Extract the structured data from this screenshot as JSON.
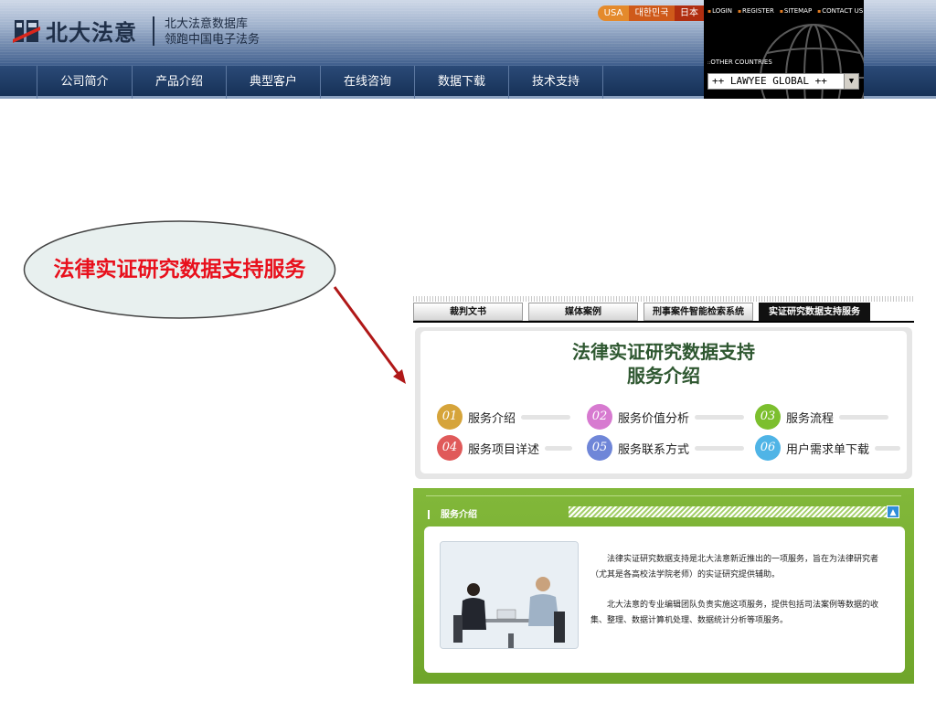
{
  "brand": {
    "logo_text": "北大法意",
    "tagline_1": "北大法意数据库",
    "tagline_2": "领跑中国电子法务"
  },
  "languages": [
    "USA",
    "대한민국",
    "日本"
  ],
  "utility_links": [
    "LOGIN",
    "REGISTER",
    "SITEMAP",
    "CONTACT US"
  ],
  "other_countries_label": "OTHER COUNTRIES",
  "country_select": {
    "value": "++  LAWYEE GLOBAL  ++"
  },
  "nav": {
    "items": [
      {
        "label": "公司简介"
      },
      {
        "label": "产品介绍"
      },
      {
        "label": "典型客户"
      },
      {
        "label": "在线咨询"
      },
      {
        "label": "数据下载"
      },
      {
        "label": "技术支持"
      }
    ]
  },
  "callout": {
    "text": "法律实证研究数据支持服务"
  },
  "panel": {
    "tabs": [
      {
        "label": "裁判文书",
        "active": false
      },
      {
        "label": "媒体案例",
        "active": false
      },
      {
        "label": "刑事案件智能检索系统",
        "active": false
      },
      {
        "label": "实证研究数据支持服务",
        "active": true
      }
    ],
    "hero_title_1": "法律实证研究数据支持",
    "hero_title_2": "服务介绍",
    "services": [
      {
        "num": "01",
        "label": "服务介绍",
        "color": "#d6a43a"
      },
      {
        "num": "02",
        "label": "服务价值分析",
        "color": "#d77ad0"
      },
      {
        "num": "03",
        "label": "服务流程",
        "color": "#7cbf2e"
      },
      {
        "num": "04",
        "label": "服务项目详述",
        "color": "#e05a5a"
      },
      {
        "num": "05",
        "label": "服务联系方式",
        "color": "#6f86d8"
      },
      {
        "num": "06",
        "label": "用户需求单下载",
        "color": "#4fb4e6"
      }
    ],
    "section_title": "服务介绍",
    "paragraph_1": "法律实证研究数据支持是北大法意新近推出的一项服务，旨在为法律研究者（尤其是各高校法学院老师）的实证研究提供辅助。",
    "paragraph_2": "北大法意的专业编辑团队负责实施这项服务，提供包括司法案例等数据的收集、整理、数据计算机处理、数据统计分析等项服务。"
  },
  "colors": {
    "callout_text": "#e8101c",
    "arrow": "#b01818",
    "panel_green": "#6fa52a",
    "nav_bg": "#163157"
  }
}
